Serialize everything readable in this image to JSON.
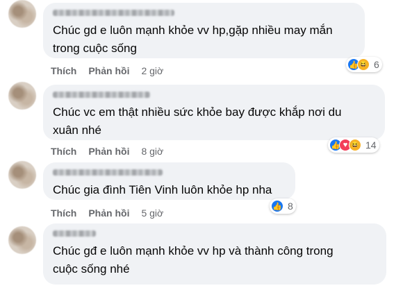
{
  "comments": [
    {
      "text": "Chúc gd e luôn mạnh khỏe vv hp,gặp nhiều may mắn\ntrong cuộc sống",
      "like_label": "Thích",
      "reply_label": "Phản hồi",
      "time": "2 giờ",
      "reactions": [
        "like-icon",
        "haha-icon"
      ],
      "reaction_count": "6"
    },
    {
      "text": "Chúc vc em thật nhiều sức khỏe bay được khắp nơi du\nxuân nhé",
      "like_label": "Thích",
      "reply_label": "Phản hồi",
      "time": "8 giờ",
      "reactions": [
        "like-icon",
        "love-icon",
        "haha-icon"
      ],
      "reaction_count": "14"
    },
    {
      "text": "Chúc gia đình Tiên Vinh luôn khỏe hp nha",
      "like_label": "Thích",
      "reply_label": "Phản hồi",
      "time": "5 giờ",
      "reactions": [
        "like-icon"
      ],
      "reaction_count": "8"
    },
    {
      "text": "Chúc gđ e luôn mạnh khỏe vv hp và thành công trong\ncuộc sống nhé"
    }
  ],
  "colors": {
    "bubble": "#f0f2f5",
    "meta": "#65676b",
    "like": "#1877f2",
    "haha": "#f7b125"
  }
}
